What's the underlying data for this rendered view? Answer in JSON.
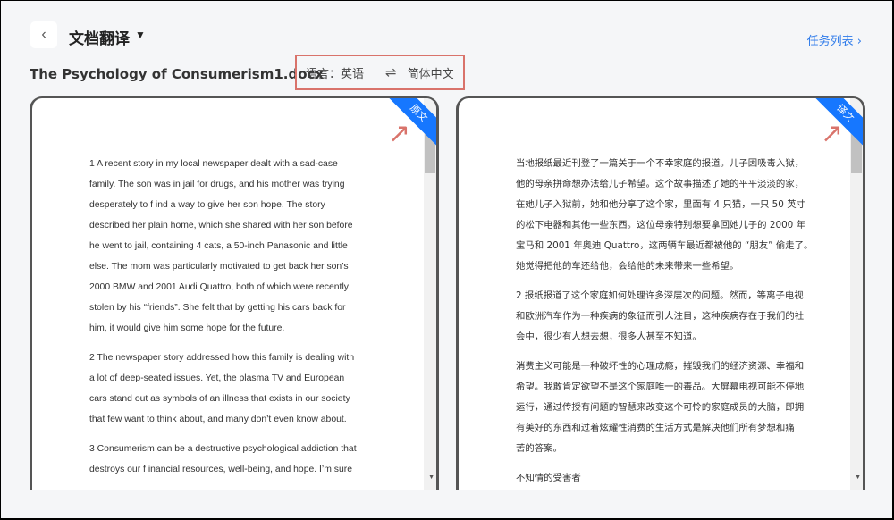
{
  "header": {
    "back_icon": "chevron-left-icon",
    "title": "文档翻译",
    "dropdown_icon": "caret-down-icon",
    "task_list": "任务列表 ›"
  },
  "file": {
    "name": "The Psychology of Consumerism1.docx"
  },
  "language": {
    "label": "语言：英语",
    "swap_icon": "⇌",
    "target": "简体中文"
  },
  "panels": {
    "source": {
      "badge": "原文",
      "paragraphs": [
        "1 A recent story in my local newspaper dealt with a sad-case\nfamily. The son was in jail for drugs, and his mother was trying\ndesperately to f ind a way to give her son hope. The story\ndescribed her plain home, which she shared with her son before\nhe went to jail, containing 4 cats, a 50-inch Panasonic and little\nelse. The mom was particularly motivated to get back her son’s\n2000 BMW and 2001 Audi Quattro, both of which were recently\nstolen by his “friends”. She felt that by getting his cars back for\nhim, it would give him some hope for the future.",
        "2 The newspaper story addressed how this family is dealing with\na lot of deep-seated issues. Yet, the plasma TV and European\ncars stand out as symbols of an illness that exists in our society\nthat few want to think about, and many don’t even know about.",
        "3 Consumerism can be a destructive psychological addiction that\ndestroys our f inancial resources, well-being, and hope. I’m sure"
      ]
    },
    "target": {
      "badge": "译文",
      "paragraphs": [
        "当地报纸最近刊登了一篇关于一个不幸家庭的报道。儿子因吸毒入狱，\n他的母亲拼命想办法给儿子希望。这个故事描述了她的平平淡淡的家，\n在她儿子入狱前，她和他分享了这个家，里面有 4 只猫，一只 50 英寸\n的松下电器和其他一些东西。这位母亲特别想要拿回她儿子的 2000 年\n宝马和 2001 年奥迪 Quattro，这两辆车最近都被他的 “朋友” 偷走了。\n她觉得把他的车还给他，会给他的未来带来一些希望。",
        "2 报纸报道了这个家庭如何处理许多深层次的问题。然而，等离子电视\n和欧洲汽车作为一种疾病的象征而引人注目，这种疾病存在于我们的社\n会中，很少有人想去想，很多人甚至不知道。",
        "消费主义可能是一种破坏性的心理成瘾，摧毁我们的经济资源、幸福和\n希望。我敢肯定欲望不是这个家庭唯一的毒品。大屏幕电视可能不停地\n运行，通过传授有问题的智慧来改变这个可怜的家庭成员的大脑，即拥\n有美好的东西和过着炫耀性消费的生活方式是解决他们所有梦想和痛\n苦的答案。",
        "不知情的受害者"
      ]
    }
  },
  "colors": {
    "accent": "#1677ff",
    "annotation": "#d9736b"
  }
}
